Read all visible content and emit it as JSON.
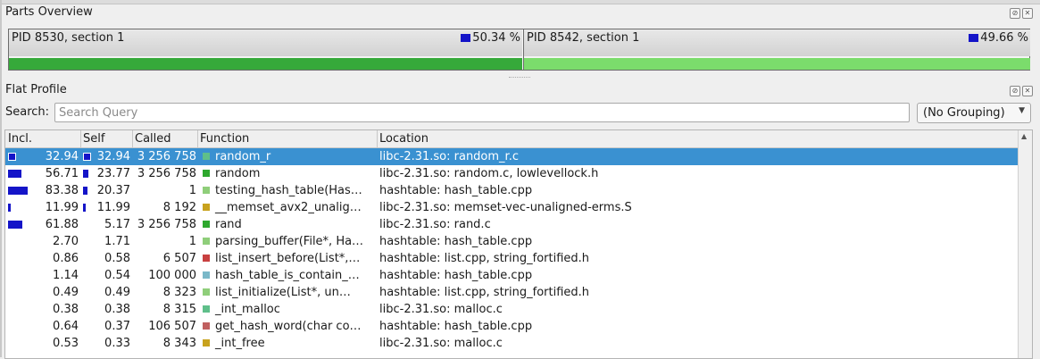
{
  "parts_overview": {
    "title": "Parts Overview",
    "parts": [
      {
        "label": "PID 8530, section 1",
        "percent": "50.34 %",
        "share": 50.34
      },
      {
        "label": "PID 8542, section 1",
        "percent": "49.66 %",
        "share": 49.66
      }
    ]
  },
  "flat_profile": {
    "title": "Flat Profile",
    "search_label": "Search:",
    "search_placeholder": "Search Query",
    "grouping": "(No Grouping)",
    "columns": [
      "Incl.",
      "Self",
      "Called",
      "Function",
      "Location"
    ],
    "rows": [
      {
        "incl": "32.94",
        "self": "32.94",
        "called": "3 256 758",
        "function": "random_r",
        "location": "libc-2.31.so: random_r.c",
        "swatch": "#5fbf8a",
        "incl_bar": 32.94,
        "self_bar": 32.94,
        "selected": true
      },
      {
        "incl": "56.71",
        "self": "23.77",
        "called": "3 256 758",
        "function": "random",
        "location": "libc-2.31.so: random.c, lowlevellock.h",
        "swatch": "#2ea82e",
        "incl_bar": 56.71,
        "self_bar": 23.77
      },
      {
        "incl": "83.38",
        "self": "20.37",
        "called": "1",
        "function": "testing_hash_table(Has…",
        "location": "hashtable: hash_table.cpp",
        "swatch": "#8fce7a",
        "incl_bar": 83.38,
        "self_bar": 20.37
      },
      {
        "incl": "11.99",
        "self": "11.99",
        "called": "8 192",
        "function": "__memset_avx2_unalig…",
        "location": "libc-2.31.so: memset-vec-unaligned-erms.S",
        "swatch": "#c8a21e",
        "incl_bar": 11.99,
        "self_bar": 11.99
      },
      {
        "incl": "61.88",
        "self": "5.17",
        "called": "3 256 758",
        "function": "rand",
        "location": "libc-2.31.so: rand.c",
        "swatch": "#2ea82e",
        "incl_bar": 61.88,
        "self_bar": 0
      },
      {
        "incl": "2.70",
        "self": "1.71",
        "called": "1",
        "function": "parsing_buffer(File*, Ha…",
        "location": "hashtable: hash_table.cpp",
        "swatch": "#8fce7a",
        "incl_bar": 0,
        "self_bar": 0
      },
      {
        "incl": "0.86",
        "self": "0.58",
        "called": "6 507",
        "function": "list_insert_before(List*,…",
        "location": "hashtable: list.cpp, string_fortified.h",
        "swatch": "#c84040",
        "incl_bar": 0,
        "self_bar": 0
      },
      {
        "incl": "1.14",
        "self": "0.54",
        "called": "100 000",
        "function": "hash_table_is_contain_…",
        "location": "hashtable: hash_table.cpp",
        "swatch": "#7ab8c8",
        "incl_bar": 0,
        "self_bar": 0
      },
      {
        "incl": "0.49",
        "self": "0.49",
        "called": "8 323",
        "function": "list_initialize(List*, un…",
        "location": "hashtable: list.cpp, string_fortified.h",
        "swatch": "#8fce7a",
        "incl_bar": 0,
        "self_bar": 0
      },
      {
        "incl": "0.38",
        "self": "0.38",
        "called": "8 315",
        "function": "_int_malloc",
        "location": "libc-2.31.so: malloc.c",
        "swatch": "#5fbf8a",
        "incl_bar": 0,
        "self_bar": 0
      },
      {
        "incl": "0.64",
        "self": "0.37",
        "called": "106 507",
        "function": "get_hash_word(char co…",
        "location": "hashtable: hash_table.cpp",
        "swatch": "#c06060",
        "incl_bar": 0,
        "self_bar": 0
      },
      {
        "incl": "0.53",
        "self": "0.33",
        "called": "8 343",
        "function": "_int_free",
        "location": "libc-2.31.so: malloc.c",
        "swatch": "#c8a21e",
        "incl_bar": 0,
        "self_bar": 0
      }
    ]
  }
}
